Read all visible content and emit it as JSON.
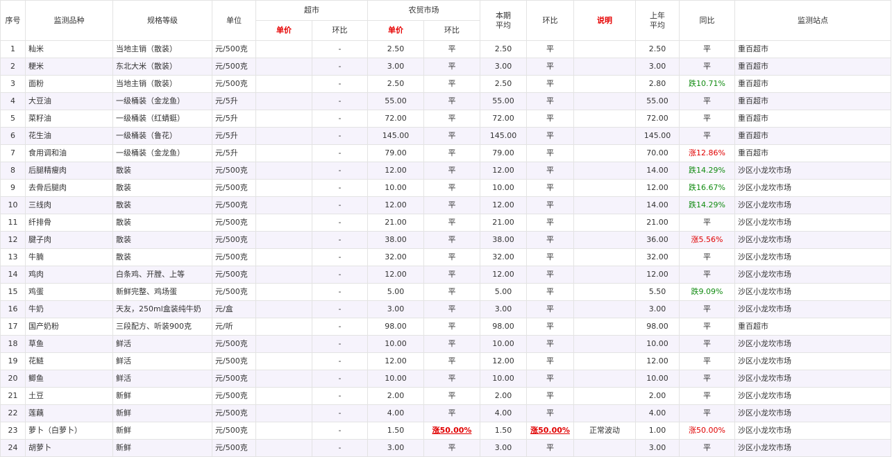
{
  "header": {
    "seq": "序号",
    "item": "监测品种",
    "spec": "规格等级",
    "unit": "单位",
    "supermarket": "超市",
    "farm_market": "农贸市场",
    "current_avg": "本期\n平均",
    "mom": "环比",
    "note": "说明",
    "last_year_avg": "上年\n平均",
    "yoy": "同比",
    "station": "监测站点",
    "price": "单价",
    "sub_mom": "环比"
  },
  "rows": [
    {
      "seq": "1",
      "item": "籼米",
      "spec": "当地主销（散装）",
      "unit": "元/500克",
      "sm_price": "",
      "sm_mom": "-",
      "fm_price": "2.50",
      "fm_mom": "平",
      "avg": "2.50",
      "mom": "平",
      "note": "",
      "ly_avg": "2.50",
      "yoy": "平",
      "yoy_type": "",
      "station": "重百超市"
    },
    {
      "seq": "2",
      "item": "粳米",
      "spec": "东北大米（散装）",
      "unit": "元/500克",
      "sm_price": "",
      "sm_mom": "-",
      "fm_price": "3.00",
      "fm_mom": "平",
      "avg": "3.00",
      "mom": "平",
      "note": "",
      "ly_avg": "3.00",
      "yoy": "平",
      "yoy_type": "",
      "station": "重百超市"
    },
    {
      "seq": "3",
      "item": "面粉",
      "spec": "当地主销（散装）",
      "unit": "元/500克",
      "sm_price": "",
      "sm_mom": "-",
      "fm_price": "2.50",
      "fm_mom": "平",
      "avg": "2.50",
      "mom": "平",
      "note": "",
      "ly_avg": "2.80",
      "yoy": "跌10.71%",
      "yoy_type": "down",
      "station": "重百超市"
    },
    {
      "seq": "4",
      "item": "大豆油",
      "spec": "一级桶装（金龙鱼）",
      "unit": "元/5升",
      "sm_price": "",
      "sm_mom": "-",
      "fm_price": "55.00",
      "fm_mom": "平",
      "avg": "55.00",
      "mom": "平",
      "note": "",
      "ly_avg": "55.00",
      "yoy": "平",
      "yoy_type": "",
      "station": "重百超市"
    },
    {
      "seq": "5",
      "item": "菜籽油",
      "spec": "一级桶装（红蜻蜓）",
      "unit": "元/5升",
      "sm_price": "",
      "sm_mom": "-",
      "fm_price": "72.00",
      "fm_mom": "平",
      "avg": "72.00",
      "mom": "平",
      "note": "",
      "ly_avg": "72.00",
      "yoy": "平",
      "yoy_type": "",
      "station": "重百超市"
    },
    {
      "seq": "6",
      "item": "花生油",
      "spec": "一级桶装（鲁花）",
      "unit": "元/5升",
      "sm_price": "",
      "sm_mom": "-",
      "fm_price": "145.00",
      "fm_mom": "平",
      "avg": "145.00",
      "mom": "平",
      "note": "",
      "ly_avg": "145.00",
      "yoy": "平",
      "yoy_type": "",
      "station": "重百超市"
    },
    {
      "seq": "7",
      "item": "食用调和油",
      "spec": "一级桶装（金龙鱼）",
      "unit": "元/5升",
      "sm_price": "",
      "sm_mom": "-",
      "fm_price": "79.00",
      "fm_mom": "平",
      "avg": "79.00",
      "mom": "平",
      "note": "",
      "ly_avg": "70.00",
      "yoy": "涨12.86%",
      "yoy_type": "up",
      "station": "重百超市"
    },
    {
      "seq": "8",
      "item": "后腿精瘦肉",
      "spec": "散装",
      "unit": "元/500克",
      "sm_price": "",
      "sm_mom": "-",
      "fm_price": "12.00",
      "fm_mom": "平",
      "avg": "12.00",
      "mom": "平",
      "note": "",
      "ly_avg": "14.00",
      "yoy": "跌14.29%",
      "yoy_type": "down",
      "station": "沙区小龙坎市场"
    },
    {
      "seq": "9",
      "item": "去骨后腿肉",
      "spec": "散装",
      "unit": "元/500克",
      "sm_price": "",
      "sm_mom": "-",
      "fm_price": "10.00",
      "fm_mom": "平",
      "avg": "10.00",
      "mom": "平",
      "note": "",
      "ly_avg": "12.00",
      "yoy": "跌16.67%",
      "yoy_type": "down",
      "station": "沙区小龙坎市场"
    },
    {
      "seq": "10",
      "item": "三线肉",
      "spec": "散装",
      "unit": "元/500克",
      "sm_price": "",
      "sm_mom": "-",
      "fm_price": "12.00",
      "fm_mom": "平",
      "avg": "12.00",
      "mom": "平",
      "note": "",
      "ly_avg": "14.00",
      "yoy": "跌14.29%",
      "yoy_type": "down",
      "station": "沙区小龙坎市场"
    },
    {
      "seq": "11",
      "item": "纤排骨",
      "spec": "散装",
      "unit": "元/500克",
      "sm_price": "",
      "sm_mom": "-",
      "fm_price": "21.00",
      "fm_mom": "平",
      "avg": "21.00",
      "mom": "平",
      "note": "",
      "ly_avg": "21.00",
      "yoy": "平",
      "yoy_type": "",
      "station": "沙区小龙坎市场"
    },
    {
      "seq": "12",
      "item": "腱子肉",
      "spec": "散装",
      "unit": "元/500克",
      "sm_price": "",
      "sm_mom": "-",
      "fm_price": "38.00",
      "fm_mom": "平",
      "avg": "38.00",
      "mom": "平",
      "note": "",
      "ly_avg": "36.00",
      "yoy": "涨5.56%",
      "yoy_type": "up",
      "station": "沙区小龙坎市场"
    },
    {
      "seq": "13",
      "item": "牛腩",
      "spec": "散装",
      "unit": "元/500克",
      "sm_price": "",
      "sm_mom": "-",
      "fm_price": "32.00",
      "fm_mom": "平",
      "avg": "32.00",
      "mom": "平",
      "note": "",
      "ly_avg": "32.00",
      "yoy": "平",
      "yoy_type": "",
      "station": "沙区小龙坎市场"
    },
    {
      "seq": "14",
      "item": "鸡肉",
      "spec": "白条鸡、开膛、上等",
      "unit": "元/500克",
      "sm_price": "",
      "sm_mom": "-",
      "fm_price": "12.00",
      "fm_mom": "平",
      "avg": "12.00",
      "mom": "平",
      "note": "",
      "ly_avg": "12.00",
      "yoy": "平",
      "yoy_type": "",
      "station": "沙区小龙坎市场"
    },
    {
      "seq": "15",
      "item": "鸡蛋",
      "spec": "新鲜完整、鸡场蛋",
      "unit": "元/500克",
      "sm_price": "",
      "sm_mom": "-",
      "fm_price": "5.00",
      "fm_mom": "平",
      "avg": "5.00",
      "mom": "平",
      "note": "",
      "ly_avg": "5.50",
      "yoy": "跌9.09%",
      "yoy_type": "down",
      "station": "沙区小龙坎市场"
    },
    {
      "seq": "16",
      "item": "牛奶",
      "spec": "天友，250ml盒装纯牛奶",
      "unit": "元/盒",
      "sm_price": "",
      "sm_mom": "-",
      "fm_price": "3.00",
      "fm_mom": "平",
      "avg": "3.00",
      "mom": "平",
      "note": "",
      "ly_avg": "3.00",
      "yoy": "平",
      "yoy_type": "",
      "station": "沙区小龙坎市场"
    },
    {
      "seq": "17",
      "item": "国产奶粉",
      "spec": "三段配方、听装900克",
      "unit": "元/听",
      "sm_price": "",
      "sm_mom": "-",
      "fm_price": "98.00",
      "fm_mom": "平",
      "avg": "98.00",
      "mom": "平",
      "note": "",
      "ly_avg": "98.00",
      "yoy": "平",
      "yoy_type": "",
      "station": "重百超市"
    },
    {
      "seq": "18",
      "item": "草鱼",
      "spec": "鲜活",
      "unit": "元/500克",
      "sm_price": "",
      "sm_mom": "-",
      "fm_price": "10.00",
      "fm_mom": "平",
      "avg": "10.00",
      "mom": "平",
      "note": "",
      "ly_avg": "10.00",
      "yoy": "平",
      "yoy_type": "",
      "station": "沙区小龙坎市场"
    },
    {
      "seq": "19",
      "item": "花鲢",
      "spec": "鲜活",
      "unit": "元/500克",
      "sm_price": "",
      "sm_mom": "-",
      "fm_price": "12.00",
      "fm_mom": "平",
      "avg": "12.00",
      "mom": "平",
      "note": "",
      "ly_avg": "12.00",
      "yoy": "平",
      "yoy_type": "",
      "station": "沙区小龙坎市场"
    },
    {
      "seq": "20",
      "item": "鲫鱼",
      "spec": "鲜活",
      "unit": "元/500克",
      "sm_price": "",
      "sm_mom": "-",
      "fm_price": "10.00",
      "fm_mom": "平",
      "avg": "10.00",
      "mom": "平",
      "note": "",
      "ly_avg": "10.00",
      "yoy": "平",
      "yoy_type": "",
      "station": "沙区小龙坎市场"
    },
    {
      "seq": "21",
      "item": "土豆",
      "spec": "新鲜",
      "unit": "元/500克",
      "sm_price": "",
      "sm_mom": "-",
      "fm_price": "2.00",
      "fm_mom": "平",
      "avg": "2.00",
      "mom": "平",
      "note": "",
      "ly_avg": "2.00",
      "yoy": "平",
      "yoy_type": "",
      "station": "沙区小龙坎市场"
    },
    {
      "seq": "22",
      "item": "莲藕",
      "spec": "新鲜",
      "unit": "元/500克",
      "sm_price": "",
      "sm_mom": "-",
      "fm_price": "4.00",
      "fm_mom": "平",
      "avg": "4.00",
      "mom": "平",
      "note": "",
      "ly_avg": "4.00",
      "yoy": "平",
      "yoy_type": "",
      "station": "沙区小龙坎市场"
    },
    {
      "seq": "23",
      "item": "萝卜（白萝卜）",
      "spec": "新鲜",
      "unit": "元/500克",
      "sm_price": "",
      "sm_mom": "-",
      "fm_price": "1.50",
      "fm_mom": "涨50.00%",
      "fm_mom_type": "up-bold",
      "avg": "1.50",
      "mom": "涨50.00%",
      "mom_type": "up-bold",
      "note": "正常波动",
      "ly_avg": "1.00",
      "yoy": "涨50.00%",
      "yoy_type": "up",
      "station": "沙区小龙坎市场"
    },
    {
      "seq": "24",
      "item": "胡萝卜",
      "spec": "新鲜",
      "unit": "元/500克",
      "sm_price": "",
      "sm_mom": "-",
      "fm_price": "3.00",
      "fm_mom": "平",
      "avg": "3.00",
      "mom": "平",
      "note": "",
      "ly_avg": "3.00",
      "yoy": "平",
      "yoy_type": "",
      "station": "沙区小龙坎市场"
    }
  ]
}
